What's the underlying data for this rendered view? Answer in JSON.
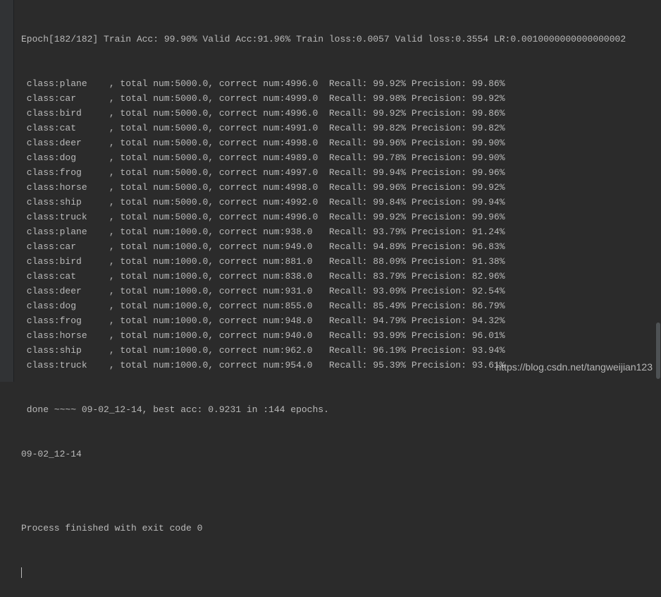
{
  "epoch_summary": "Epoch[182/182] Train Acc: 99.90% Valid Acc:91.96% Train loss:0.0057 Valid loss:0.3554 LR:0.0010000000000000002",
  "train_rows": [
    {
      "cls": "plane",
      "total": "5000.0",
      "correct": "4996.0",
      "recall": "99.92%",
      "precision": "99.86%"
    },
    {
      "cls": "car",
      "total": "5000.0",
      "correct": "4999.0",
      "recall": "99.98%",
      "precision": "99.92%"
    },
    {
      "cls": "bird",
      "total": "5000.0",
      "correct": "4996.0",
      "recall": "99.92%",
      "precision": "99.86%"
    },
    {
      "cls": "cat",
      "total": "5000.0",
      "correct": "4991.0",
      "recall": "99.82%",
      "precision": "99.82%"
    },
    {
      "cls": "deer",
      "total": "5000.0",
      "correct": "4998.0",
      "recall": "99.96%",
      "precision": "99.90%"
    },
    {
      "cls": "dog",
      "total": "5000.0",
      "correct": "4989.0",
      "recall": "99.78%",
      "precision": "99.90%"
    },
    {
      "cls": "frog",
      "total": "5000.0",
      "correct": "4997.0",
      "recall": "99.94%",
      "precision": "99.96%"
    },
    {
      "cls": "horse",
      "total": "5000.0",
      "correct": "4998.0",
      "recall": "99.96%",
      "precision": "99.92%"
    },
    {
      "cls": "ship",
      "total": "5000.0",
      "correct": "4992.0",
      "recall": "99.84%",
      "precision": "99.94%"
    },
    {
      "cls": "truck",
      "total": "5000.0",
      "correct": "4996.0",
      "recall": "99.92%",
      "precision": "99.96%"
    }
  ],
  "valid_rows": [
    {
      "cls": "plane",
      "total": "1000.0",
      "correct": "938.0",
      "recall": "93.79%",
      "precision": "91.24%"
    },
    {
      "cls": "car",
      "total": "1000.0",
      "correct": "949.0",
      "recall": "94.89%",
      "precision": "96.83%"
    },
    {
      "cls": "bird",
      "total": "1000.0",
      "correct": "881.0",
      "recall": "88.09%",
      "precision": "91.38%"
    },
    {
      "cls": "cat",
      "total": "1000.0",
      "correct": "838.0",
      "recall": "83.79%",
      "precision": "82.96%"
    },
    {
      "cls": "deer",
      "total": "1000.0",
      "correct": "931.0",
      "recall": "93.09%",
      "precision": "92.54%"
    },
    {
      "cls": "dog",
      "total": "1000.0",
      "correct": "855.0",
      "recall": "85.49%",
      "precision": "86.79%"
    },
    {
      "cls": "frog",
      "total": "1000.0",
      "correct": "948.0",
      "recall": "94.79%",
      "precision": "94.32%"
    },
    {
      "cls": "horse",
      "total": "1000.0",
      "correct": "940.0",
      "recall": "93.99%",
      "precision": "96.01%"
    },
    {
      "cls": "ship",
      "total": "1000.0",
      "correct": "962.0",
      "recall": "96.19%",
      "precision": "93.94%"
    },
    {
      "cls": "truck",
      "total": "1000.0",
      "correct": "954.0",
      "recall": "95.39%",
      "precision": "93.61%"
    }
  ],
  "done_line": " done ~~~~ 09-02_12-14, best acc: 0.9231 in :144 epochs.",
  "timestamp_line": "09-02_12-14",
  "blank_line": "",
  "exit_line": "Process finished with exit code 0",
  "watermark": "https://blog.csdn.net/tangweijian123"
}
